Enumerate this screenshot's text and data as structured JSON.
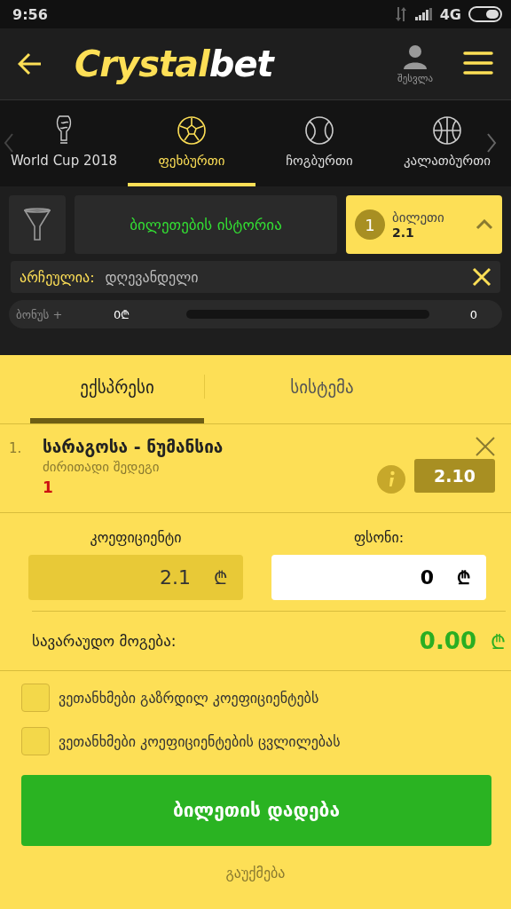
{
  "status_bar": {
    "time": "9:56",
    "network": "4G"
  },
  "header": {
    "logo_part_1": "Crystal",
    "logo_part_2": "bet",
    "login": "შესვლა"
  },
  "sports": [
    {
      "kind": "cup",
      "label": "World Cup 2018",
      "selected": false
    },
    {
      "kind": "football",
      "label": "ფეხბურთი",
      "selected": true
    },
    {
      "kind": "tennis",
      "label": "ჩოგბურთი",
      "selected": false
    },
    {
      "kind": "basketball",
      "label": "კალათბურთი",
      "selected": false
    }
  ],
  "history_button": "ბილეთების ისტორია",
  "ticket": {
    "count": "1",
    "label": "ბილეთი",
    "odds": "2.1"
  },
  "filter": {
    "label": "არჩეულია:",
    "value": "დღევანდელი"
  },
  "bonus": {
    "label": "ბონუს +",
    "amount": "0₾",
    "level": 0,
    "count": "0"
  },
  "bet_tabs": [
    {
      "label": "ექსპრესი",
      "selected": true
    },
    {
      "label": "სისტემა",
      "selected": false
    }
  ],
  "bets": [
    {
      "number": "1.",
      "match": "სარაგოსა - ნუმანსია",
      "market": "ძირითადი შედეგი",
      "pick": "1",
      "odds": "2.10"
    }
  ],
  "coefficient": {
    "label": "კოეფიციენტი",
    "value": "2.1",
    "currency": "₾"
  },
  "stake": {
    "label": "ფსონი:",
    "value": "0",
    "currency": "₾"
  },
  "winnings": {
    "label": "სავარაუდო მოგება:",
    "value": "0.00",
    "currency": "₾"
  },
  "agreements": [
    {
      "label": "ვეთანხმები გაზრდილ კოეფიციენტებს",
      "checked": false
    },
    {
      "label": "ვეთანხმები კოეფიციენტების ცვლილებას",
      "checked": false
    }
  ],
  "place_button": "ბილეთის დადება",
  "cancel": "გაუქმება"
}
